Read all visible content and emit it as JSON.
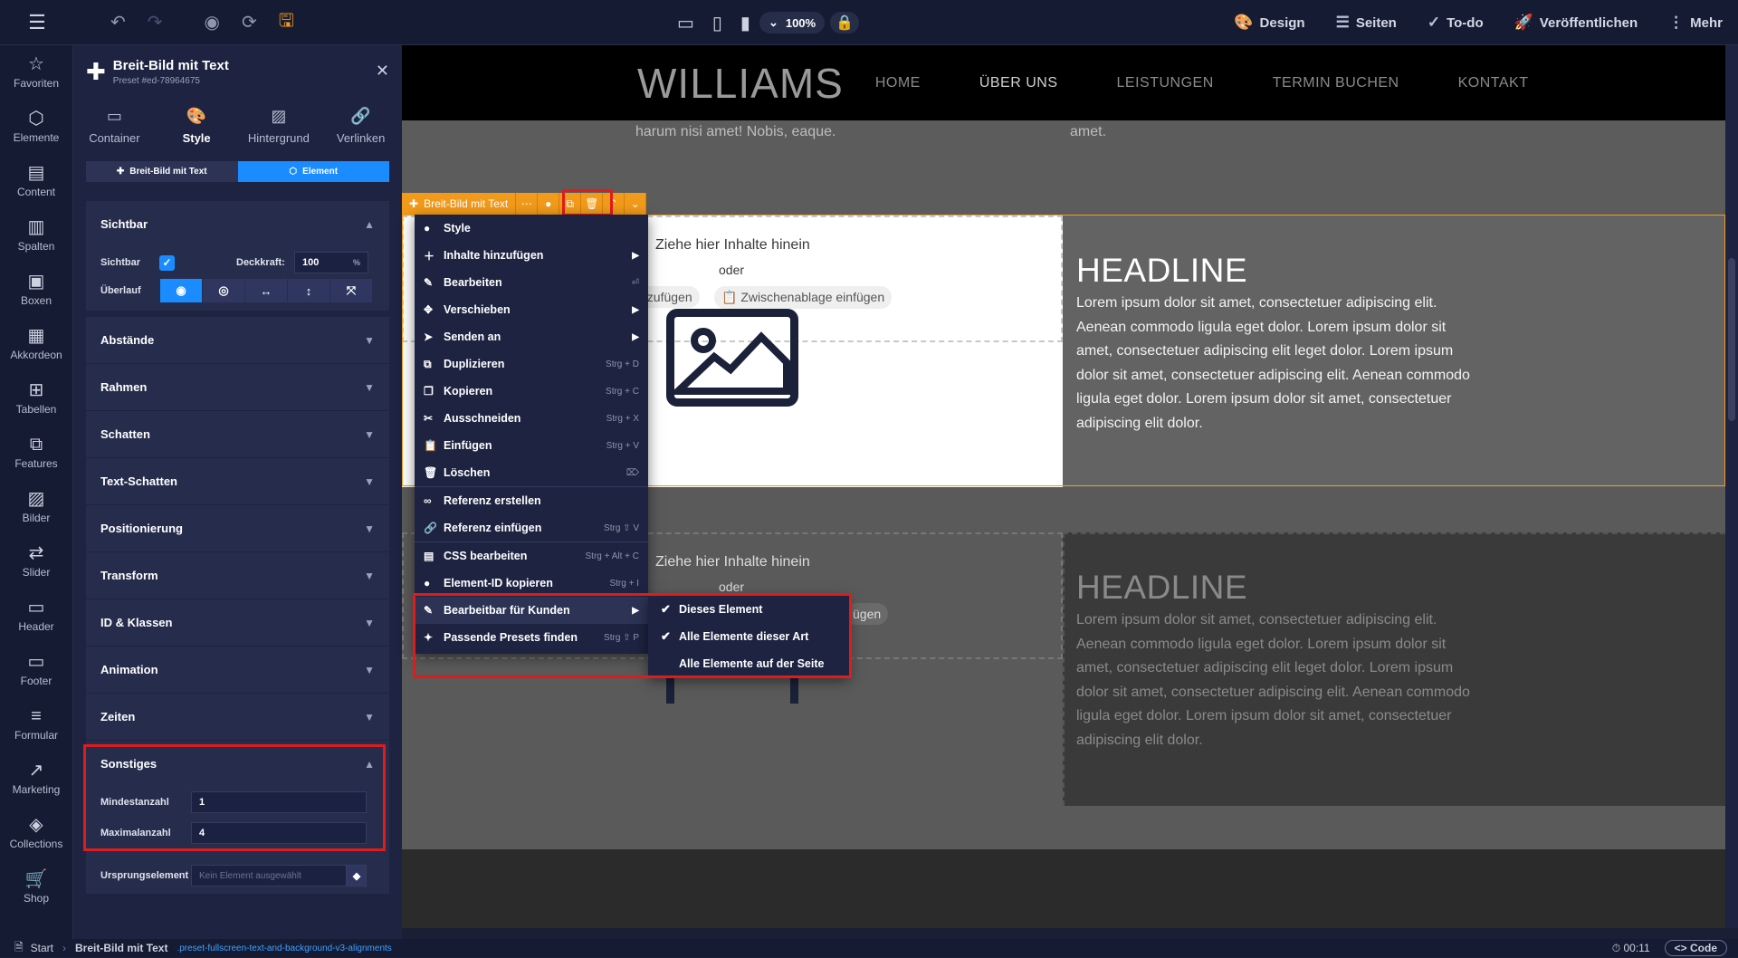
{
  "topbar": {
    "zoom": "100%",
    "menu": [
      {
        "label": "Design",
        "icon": "palette-icon"
      },
      {
        "label": "Seiten",
        "icon": "list-icon"
      },
      {
        "label": "To-do",
        "icon": "check-circle-icon"
      },
      {
        "label": "Veröffentlichen",
        "icon": "rocket-icon"
      },
      {
        "label": "Mehr",
        "icon": "more-icon"
      }
    ]
  },
  "leftnav": [
    "Favoriten",
    "Elemente",
    "Content",
    "Spalten",
    "Boxen",
    "Akkordeon",
    "Tabellen",
    "Features",
    "Bilder",
    "Slider",
    "Header",
    "Footer",
    "Formular",
    "Marketing",
    "Collections",
    "Shop"
  ],
  "panel": {
    "title": "Breit-Bild mit Text",
    "subtitle": "Preset #ed-78964675",
    "tabs": [
      "Container",
      "Style",
      "Hintergrund",
      "Verlinken"
    ],
    "segment": [
      "Breit-Bild mit Text",
      "Element"
    ],
    "sichtbar": {
      "title": "Sichtbar",
      "sichtbar_label": "Sichtbar",
      "deckkraft_label": "Deckkraft:",
      "deckkraft_value": "100",
      "deckkraft_unit": "%",
      "ueberlauf_label": "Überlauf"
    },
    "sections": [
      "Abstände",
      "Rahmen",
      "Schatten",
      "Text-Schatten",
      "Positionierung",
      "Transform",
      "ID & Klassen",
      "Animation",
      "Zeiten"
    ],
    "sonstiges": {
      "title": "Sonstiges",
      "min_label": "Mindestanzahl",
      "min_value": "1",
      "max_label": "Maximalanzahl",
      "max_value": "4",
      "ursprung_label": "Ursprungselement",
      "ursprung_placeholder": "Kein Element ausgewählt"
    }
  },
  "site": {
    "logo": "WILLIAMS",
    "nav": [
      "HOME",
      "ÜBER UNS",
      "LEISTUNGEN",
      "TERMIN BUCHEN",
      "KONTAKT"
    ],
    "top_text_left": "harum nisi amet! Nobis, eaque.",
    "top_text_right": "amet.",
    "dropzone_text": "Ziehe hier Inhalte hinein",
    "dropzone_or": "oder",
    "dropzone_btn1": "nzufügen",
    "dropzone_btn2": "Zwischenablage einfügen",
    "dropzone_btn1b": "ügen",
    "headline": "HEADLINE",
    "lorem": "Lorem ipsum dolor sit amet, consectetuer adipiscing elit. Aenean commodo ligula eget dolor. Lorem ipsum dolor sit amet, consectetuer adipiscing elit leget dolor. Lorem ipsum dolor sit amet, consectetuer adipiscing elit. Aenean commodo ligula eget dolor. Lorem ipsum dolor sit amet, consectetuer adipiscing elit dolor."
  },
  "element_toolbar": {
    "label": "Breit-Bild mit Text"
  },
  "context_menu": [
    {
      "label": "Style",
      "icon": "palette-icon",
      "shortcut": "",
      "arrow": false
    },
    {
      "label": "Inhalte hinzufügen",
      "icon": "plus-icon",
      "shortcut": "",
      "arrow": true
    },
    {
      "label": "Bearbeiten",
      "icon": "pencil-icon",
      "shortcut": "⏎",
      "arrow": false
    },
    {
      "label": "Verschieben",
      "icon": "move-icon",
      "shortcut": "",
      "arrow": true
    },
    {
      "label": "Senden an",
      "icon": "send-icon",
      "shortcut": "",
      "arrow": true
    },
    {
      "label": "Duplizieren",
      "icon": "duplicate-icon",
      "shortcut": "Strg + D",
      "arrow": false
    },
    {
      "label": "Kopieren",
      "icon": "copy-icon",
      "shortcut": "Strg + C",
      "arrow": false
    },
    {
      "label": "Ausschneiden",
      "icon": "scissors-icon",
      "shortcut": "Strg + X",
      "arrow": false
    },
    {
      "label": "Einfügen",
      "icon": "paste-icon",
      "shortcut": "Strg + V",
      "arrow": false
    },
    {
      "label": "Löschen",
      "icon": "trash-icon",
      "shortcut": "⌦",
      "arrow": false
    },
    {
      "label": "Referenz erstellen",
      "icon": "link-icon",
      "shortcut": "",
      "arrow": false
    },
    {
      "label": "Referenz einfügen",
      "icon": "link-paste-icon",
      "shortcut": "Strg ⇧ V",
      "arrow": false
    },
    {
      "label": "CSS bearbeiten",
      "icon": "css-icon",
      "shortcut": "Strg + Alt + C",
      "arrow": false
    },
    {
      "label": "Element-ID kopieren",
      "icon": "id-icon",
      "shortcut": "Strg + I",
      "arrow": false
    },
    {
      "label": "Bearbeitbar für Kunden",
      "icon": "edit-customer-icon",
      "shortcut": "",
      "arrow": true
    },
    {
      "label": "Passende Presets finden",
      "icon": "wand-icon",
      "shortcut": "Strg ⇧ P",
      "arrow": false
    }
  ],
  "submenu": [
    {
      "label": "Dieses Element",
      "checked": true
    },
    {
      "label": "Alle Elemente dieser Art",
      "checked": true
    },
    {
      "label": "Alle Elemente auf der Seite",
      "checked": false
    }
  ],
  "status": {
    "start": "Start",
    "element": "Breit-Bild mit Text",
    "classes": ".preset-fullscreen-text-and-background-v3-alignments",
    "time": "00:11",
    "code": "Code"
  }
}
